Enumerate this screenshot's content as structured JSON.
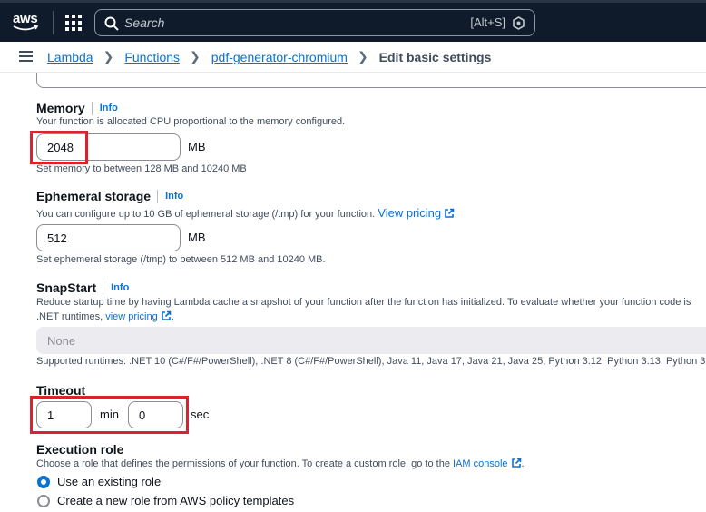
{
  "topnav": {
    "logo_text": "aws",
    "search_placeholder": "Search",
    "search_shortcut": "[Alt+S]"
  },
  "breadcrumb": {
    "items": [
      "Lambda",
      "Functions",
      "pdf-generator-chromium"
    ],
    "current": "Edit basic settings"
  },
  "memory": {
    "label": "Memory",
    "info": "Info",
    "description": "Your function is allocated CPU proportional to the memory configured.",
    "value": "2048",
    "unit": "MB",
    "constraint": "Set memory to between 128 MB and 10240 MB"
  },
  "ephemeral": {
    "label": "Ephemeral storage",
    "info": "Info",
    "description": "You can configure up to 10 GB of ephemeral storage (/tmp) for your function.",
    "link": "View pricing",
    "value": "512",
    "unit": "MB",
    "constraint": "Set ephemeral storage (/tmp) to between 512 MB and 10240 MB."
  },
  "snapstart": {
    "label": "SnapStart",
    "info": "Info",
    "description_line1": "Reduce startup time by having Lambda cache a snapshot of your function after the function has initialized. To evaluate whether your function code is",
    "description_line2_prefix": ".NET runtimes,",
    "description_link": "view pricing",
    "description_line2_suffix": ".",
    "select_value": "None",
    "supported": "Supported runtimes: .NET 10 (C#/F#/PowerShell), .NET 8 (C#/F#/PowerShell), Java 11, Java 17, Java 21, Java 25, Python 3.12, Python 3.13, Python 3."
  },
  "timeout": {
    "label": "Timeout",
    "min_value": "1",
    "min_unit": "min",
    "sec_value": "0",
    "sec_unit": "sec"
  },
  "execution_role": {
    "label": "Execution role",
    "description_prefix": "Choose a role that defines the permissions of your function. To create a custom role, go to the",
    "link": "IAM console",
    "description_suffix": ".",
    "options": [
      {
        "label": "Use an existing role",
        "selected": true
      },
      {
        "label": "Create a new role from AWS policy templates",
        "selected": false
      }
    ]
  },
  "colors": {
    "nav_bg": "#0f1b2a",
    "link": "#0972d3",
    "highlight": "#d9232e"
  }
}
